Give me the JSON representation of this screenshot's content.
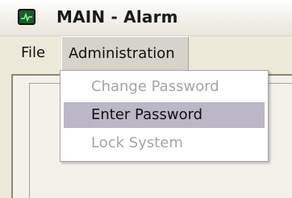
{
  "window": {
    "title": "MAIN - Alarm",
    "icon": "alarm-monitor-icon"
  },
  "menubar": {
    "items": [
      {
        "label": "File"
      },
      {
        "label": "Administration",
        "open": true
      }
    ]
  },
  "dropdown": {
    "items": [
      {
        "label": "Change Password",
        "enabled": false,
        "selected": false
      },
      {
        "label": "Enter Password",
        "enabled": true,
        "selected": true
      },
      {
        "label": "Lock System",
        "enabled": false,
        "selected": false
      }
    ]
  },
  "colors": {
    "highlight": "#bbb7c7",
    "disabled_text": "#a5a5a5",
    "icon_screen": "#1d5a2a"
  }
}
